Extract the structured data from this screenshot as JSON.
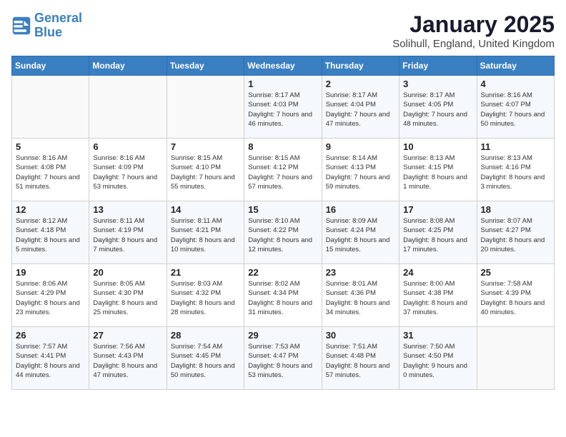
{
  "header": {
    "logo_line1": "General",
    "logo_line2": "Blue",
    "month": "January 2025",
    "location": "Solihull, England, United Kingdom"
  },
  "weekdays": [
    "Sunday",
    "Monday",
    "Tuesday",
    "Wednesday",
    "Thursday",
    "Friday",
    "Saturday"
  ],
  "weeks": [
    [
      {
        "day": "",
        "info": ""
      },
      {
        "day": "",
        "info": ""
      },
      {
        "day": "",
        "info": ""
      },
      {
        "day": "1",
        "info": "Sunrise: 8:17 AM\nSunset: 4:03 PM\nDaylight: 7 hours and 46 minutes."
      },
      {
        "day": "2",
        "info": "Sunrise: 8:17 AM\nSunset: 4:04 PM\nDaylight: 7 hours and 47 minutes."
      },
      {
        "day": "3",
        "info": "Sunrise: 8:17 AM\nSunset: 4:05 PM\nDaylight: 7 hours and 48 minutes."
      },
      {
        "day": "4",
        "info": "Sunrise: 8:16 AM\nSunset: 4:07 PM\nDaylight: 7 hours and 50 minutes."
      }
    ],
    [
      {
        "day": "5",
        "info": "Sunrise: 8:16 AM\nSunset: 4:08 PM\nDaylight: 7 hours and 51 minutes."
      },
      {
        "day": "6",
        "info": "Sunrise: 8:16 AM\nSunset: 4:09 PM\nDaylight: 7 hours and 53 minutes."
      },
      {
        "day": "7",
        "info": "Sunrise: 8:15 AM\nSunset: 4:10 PM\nDaylight: 7 hours and 55 minutes."
      },
      {
        "day": "8",
        "info": "Sunrise: 8:15 AM\nSunset: 4:12 PM\nDaylight: 7 hours and 57 minutes."
      },
      {
        "day": "9",
        "info": "Sunrise: 8:14 AM\nSunset: 4:13 PM\nDaylight: 7 hours and 59 minutes."
      },
      {
        "day": "10",
        "info": "Sunrise: 8:13 AM\nSunset: 4:15 PM\nDaylight: 8 hours and 1 minute."
      },
      {
        "day": "11",
        "info": "Sunrise: 8:13 AM\nSunset: 4:16 PM\nDaylight: 8 hours and 3 minutes."
      }
    ],
    [
      {
        "day": "12",
        "info": "Sunrise: 8:12 AM\nSunset: 4:18 PM\nDaylight: 8 hours and 5 minutes."
      },
      {
        "day": "13",
        "info": "Sunrise: 8:11 AM\nSunset: 4:19 PM\nDaylight: 8 hours and 7 minutes."
      },
      {
        "day": "14",
        "info": "Sunrise: 8:11 AM\nSunset: 4:21 PM\nDaylight: 8 hours and 10 minutes."
      },
      {
        "day": "15",
        "info": "Sunrise: 8:10 AM\nSunset: 4:22 PM\nDaylight: 8 hours and 12 minutes."
      },
      {
        "day": "16",
        "info": "Sunrise: 8:09 AM\nSunset: 4:24 PM\nDaylight: 8 hours and 15 minutes."
      },
      {
        "day": "17",
        "info": "Sunrise: 8:08 AM\nSunset: 4:25 PM\nDaylight: 8 hours and 17 minutes."
      },
      {
        "day": "18",
        "info": "Sunrise: 8:07 AM\nSunset: 4:27 PM\nDaylight: 8 hours and 20 minutes."
      }
    ],
    [
      {
        "day": "19",
        "info": "Sunrise: 8:06 AM\nSunset: 4:29 PM\nDaylight: 8 hours and 23 minutes."
      },
      {
        "day": "20",
        "info": "Sunrise: 8:05 AM\nSunset: 4:30 PM\nDaylight: 8 hours and 25 minutes."
      },
      {
        "day": "21",
        "info": "Sunrise: 8:03 AM\nSunset: 4:32 PM\nDaylight: 8 hours and 28 minutes."
      },
      {
        "day": "22",
        "info": "Sunrise: 8:02 AM\nSunset: 4:34 PM\nDaylight: 8 hours and 31 minutes."
      },
      {
        "day": "23",
        "info": "Sunrise: 8:01 AM\nSunset: 4:36 PM\nDaylight: 8 hours and 34 minutes."
      },
      {
        "day": "24",
        "info": "Sunrise: 8:00 AM\nSunset: 4:38 PM\nDaylight: 8 hours and 37 minutes."
      },
      {
        "day": "25",
        "info": "Sunrise: 7:58 AM\nSunset: 4:39 PM\nDaylight: 8 hours and 40 minutes."
      }
    ],
    [
      {
        "day": "26",
        "info": "Sunrise: 7:57 AM\nSunset: 4:41 PM\nDaylight: 8 hours and 44 minutes."
      },
      {
        "day": "27",
        "info": "Sunrise: 7:56 AM\nSunset: 4:43 PM\nDaylight: 8 hours and 47 minutes."
      },
      {
        "day": "28",
        "info": "Sunrise: 7:54 AM\nSunset: 4:45 PM\nDaylight: 8 hours and 50 minutes."
      },
      {
        "day": "29",
        "info": "Sunrise: 7:53 AM\nSunset: 4:47 PM\nDaylight: 8 hours and 53 minutes."
      },
      {
        "day": "30",
        "info": "Sunrise: 7:51 AM\nSunset: 4:48 PM\nDaylight: 8 hours and 57 minutes."
      },
      {
        "day": "31",
        "info": "Sunrise: 7:50 AM\nSunset: 4:50 PM\nDaylight: 9 hours and 0 minutes."
      },
      {
        "day": "",
        "info": ""
      }
    ]
  ]
}
